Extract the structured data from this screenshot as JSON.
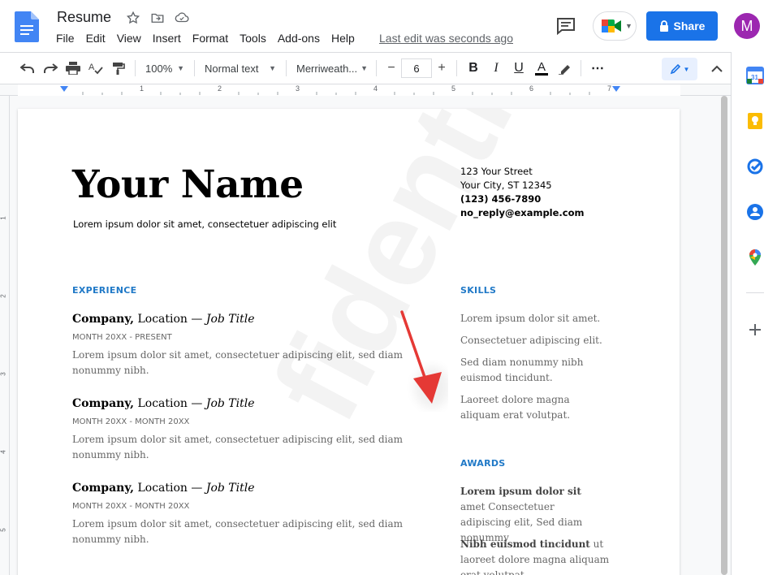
{
  "doc": {
    "title": "Resume",
    "last_edit": "Last edit was seconds ago"
  },
  "menu": [
    "File",
    "Edit",
    "View",
    "Insert",
    "Format",
    "Tools",
    "Add-ons",
    "Help"
  ],
  "header_actions": {
    "share_label": "Share",
    "avatar_initial": "M"
  },
  "toolbar": {
    "zoom": "100%",
    "style": "Normal text",
    "font": "Merriweath...",
    "font_size": "6",
    "bold": "B",
    "italic": "I",
    "underline": "U",
    "text_color_letter": "A",
    "more": "⋯"
  },
  "ruler": {
    "numbers": [
      "1",
      "2",
      "3",
      "4",
      "5",
      "6",
      "7"
    ]
  },
  "vruler": {
    "numbers": [
      "1",
      "2",
      "3",
      "4",
      "5"
    ]
  },
  "resume": {
    "name": "Your Name",
    "tagline": "Lorem ipsum dolor sit amet, consectetuer adipiscing elit",
    "contact": {
      "street": "123 Your Street",
      "city": "Your City, ST 12345",
      "phone": "(123) 456-7890",
      "email": "no_reply@example.com"
    },
    "experience_heading": "EXPERIENCE",
    "jobs": [
      {
        "company": "Company,",
        "location": " Location — ",
        "role": "Job Title",
        "dates": "MONTH 20XX - PRESENT",
        "desc": "Lorem ipsum dolor sit amet, consectetuer adipiscing elit, sed diam nonummy nibh."
      },
      {
        "company": "Company,",
        "location": " Location — ",
        "role": "Job Title",
        "dates": "MONTH 20XX - MONTH 20XX",
        "desc": "Lorem ipsum dolor sit amet, consectetuer adipiscing elit, sed diam nonummy nibh."
      },
      {
        "company": "Company,",
        "location": " Location — ",
        "role": "Job Title",
        "dates": "MONTH 20XX - MONTH 20XX",
        "desc": "Lorem ipsum dolor sit amet, consectetuer adipiscing elit, sed diam nonummy nibh."
      }
    ],
    "skills_heading": "SKILLS",
    "skills": [
      "Lorem ipsum dolor sit amet.",
      "Consectetuer adipiscing elit.",
      "Sed diam nonummy nibh euismod tincidunt.",
      "Laoreet dolore magna aliquam erat volutpat."
    ],
    "awards_heading": "AWARDS",
    "awards": [
      {
        "bold": "Lorem ipsum dolor sit",
        "rest": " amet Consectetuer adipiscing elit, Sed diam nonummy"
      },
      {
        "bold": "Nibh euismod tincidunt",
        "rest": " ut laoreet dolore magna aliquam erat volutpat."
      }
    ],
    "watermark": "fidential"
  },
  "colors": {
    "share_blue": "#1a73e8",
    "heading_blue": "#2079c7",
    "avatar_purple": "#9c27b0",
    "arrow_red": "#e53935"
  },
  "side_panel_icons": [
    "calendar-icon",
    "keep-icon",
    "tasks-icon",
    "contacts-icon",
    "maps-icon",
    "add-icon"
  ]
}
